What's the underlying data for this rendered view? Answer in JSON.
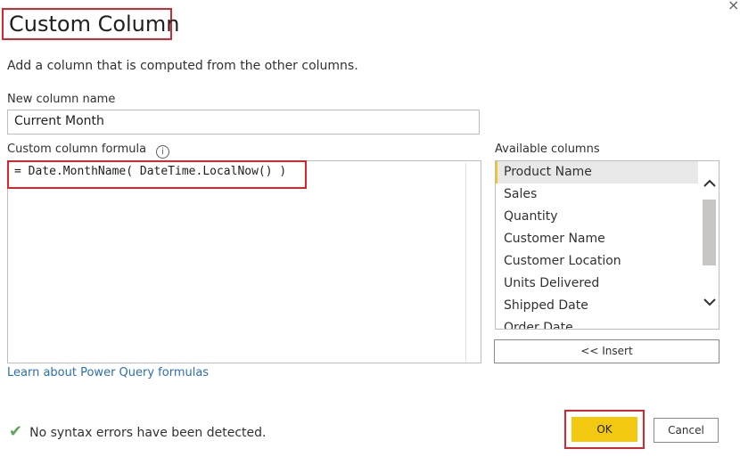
{
  "dialog": {
    "title": "Custom Column",
    "close_icon": "×",
    "description": "Add a column that is computed from the other columns."
  },
  "new_column": {
    "label": "New column name",
    "value": "Current Month"
  },
  "formula": {
    "label": "Custom column formula",
    "info_icon": "i",
    "value": "= Date.MonthName( DateTime.LocalNow() )"
  },
  "available": {
    "label": "Available columns",
    "items": [
      {
        "label": "Product Name"
      },
      {
        "label": "Sales"
      },
      {
        "label": "Quantity"
      },
      {
        "label": "Customer Name"
      },
      {
        "label": "Customer Location"
      },
      {
        "label": "Units Delivered"
      },
      {
        "label": "Shipped Date"
      },
      {
        "label": "Order Date"
      }
    ],
    "insert_label": "<< Insert",
    "scroll_up_icon": "chevron-up-icon",
    "scroll_down_icon": "chevron-down-icon"
  },
  "learn_link": "Learn about Power Query formulas",
  "status": {
    "icon": "checkmark-icon",
    "text": "No syntax errors have been detected."
  },
  "buttons": {
    "ok": "OK",
    "cancel": "Cancel"
  },
  "colors": {
    "highlight": "#d9262c",
    "ok_button": "#f2c811",
    "link": "#2c6fb3",
    "check": "#5fa55a"
  }
}
